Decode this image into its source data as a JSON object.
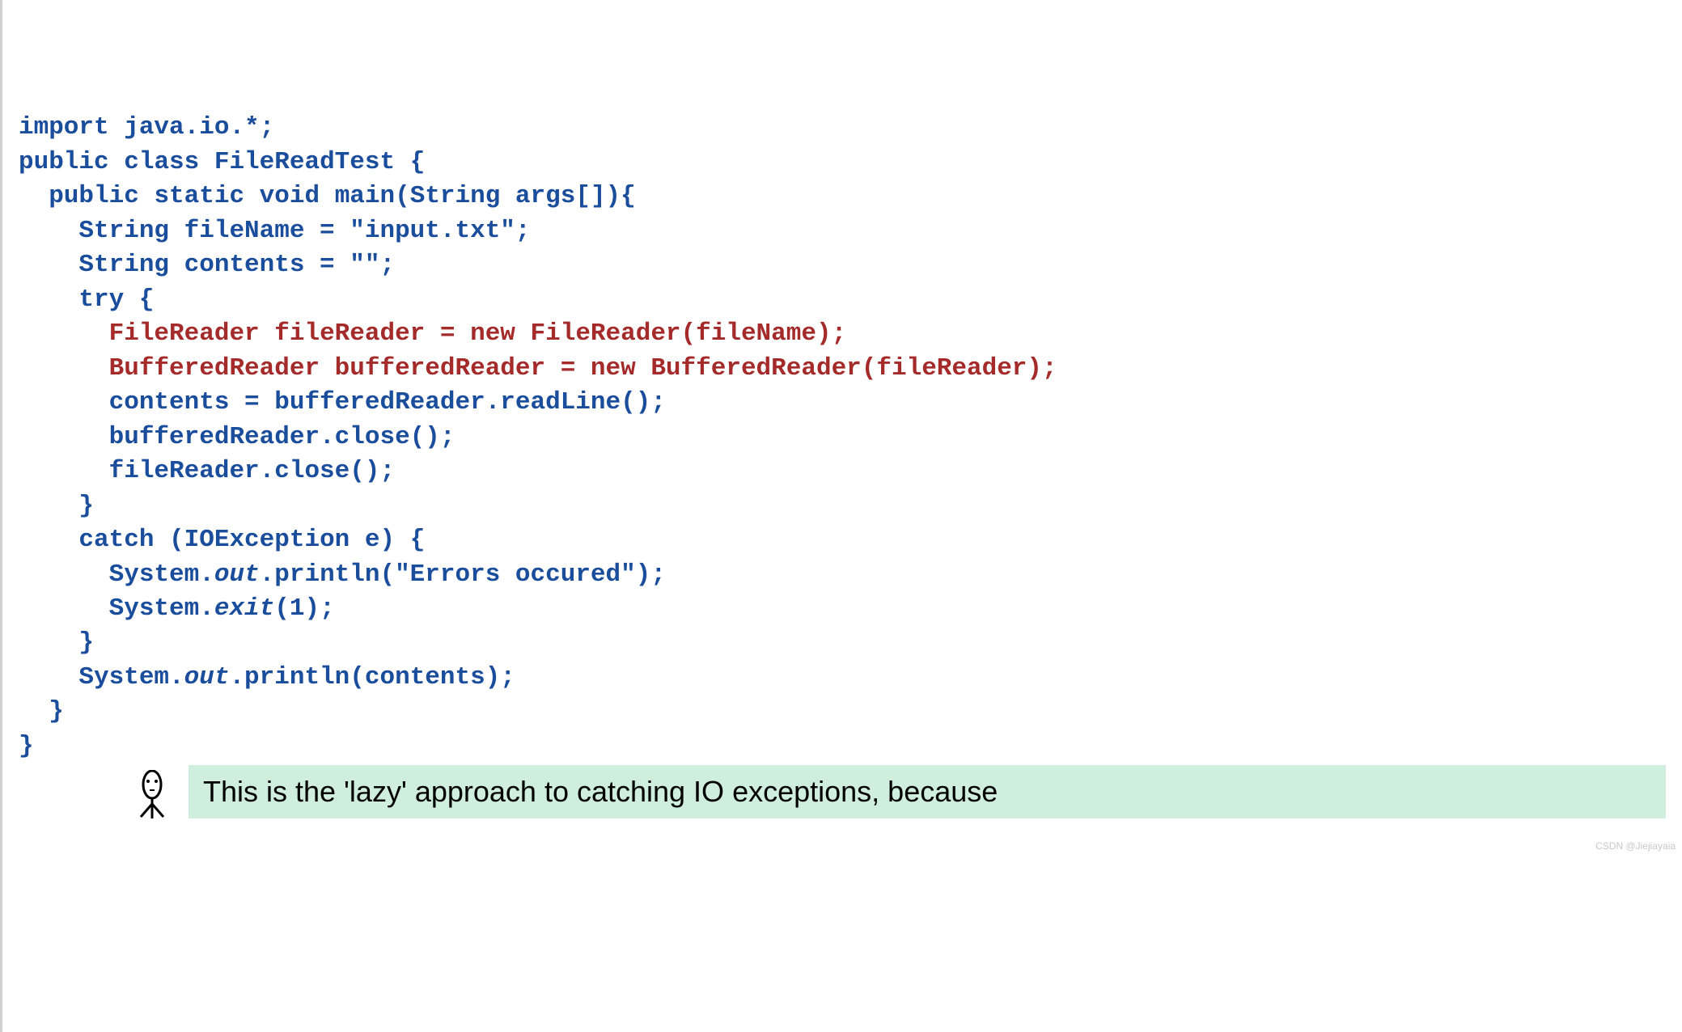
{
  "code": {
    "line1a": "import",
    "line1b": " java.io.*;",
    "line2a": "public",
    "line2b": " ",
    "line2c": "class",
    "line2d": " FileReadTest {",
    "line3a": "  public",
    "line3b": " ",
    "line3c": "static",
    "line3d": " ",
    "line3e": "void",
    "line3f": " main(String args[]){",
    "line4": "    String fileName = \"input.txt\";",
    "line5": "    String contents = \"\";",
    "line6a": "    ",
    "line6b": "try",
    "line6c": " {",
    "line7a": "      ",
    "line7b": "FileReader fileReader = new FileReader(fileName);",
    "line8a": "      ",
    "line8b": "BufferedReader bufferedReader = new BufferedReader(fileReader);",
    "line9": "      contents = bufferedReader.readLine();",
    "line10": "      bufferedReader.close();",
    "line11": "      fileReader.close();",
    "line12": "    }",
    "line13a": "    ",
    "line13b": "catch",
    "line13c": " (IOException e) {",
    "line14a": "      System.",
    "line14b": "out",
    "line14c": ".println(\"Errors occured\");",
    "line15a": "      System.",
    "line15b": "exit",
    "line15c": "(1);",
    "line16": "    }",
    "line17a": "    System.",
    "line17b": "out",
    "line17c": ".println(contents);",
    "line18": "  }",
    "line19": "}"
  },
  "callout": {
    "text": "This is the 'lazy' approach to catching IO exceptions, because"
  },
  "watermark": "CSDN @Jiejiayaia"
}
